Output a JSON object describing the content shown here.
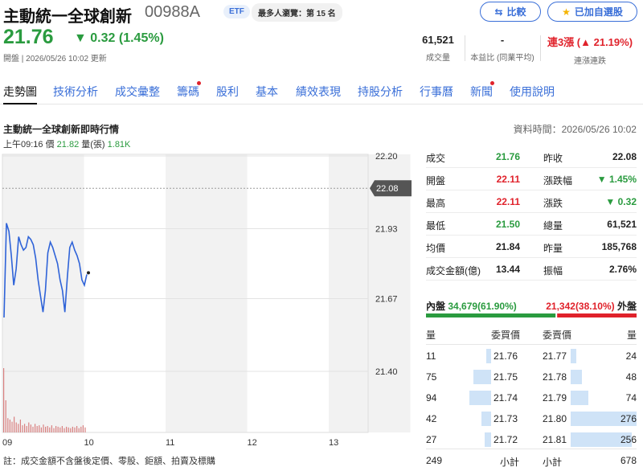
{
  "header": {
    "name": "主動統一全球創新",
    "code": "00988A",
    "etf_badge": "ETF",
    "popular_badge": "最多人瀏覽：第 15 名",
    "compare_label": "比較",
    "watchlist_label": "已加自選股",
    "price": "21.76",
    "change": "▼ 0.32 (1.45%)",
    "updated": "開盤 | 2026/05/26 10:02 更新",
    "stats": [
      {
        "value": "61,521",
        "label": "成交量"
      },
      {
        "value": "-",
        "label": "本益比 (同業平均)"
      },
      {
        "value": "連3漲 (▲ 21.19%)",
        "label": "連漲連跌"
      }
    ]
  },
  "tabs": [
    {
      "label": "走勢圖",
      "active": true,
      "dot": false
    },
    {
      "label": "技術分析",
      "dot": false
    },
    {
      "label": "成交彙整",
      "dot": false
    },
    {
      "label": "籌碼",
      "dot": true
    },
    {
      "label": "股利",
      "dot": false
    },
    {
      "label": "基本",
      "dot": false
    },
    {
      "label": "績效表現",
      "dot": false
    },
    {
      "label": "持股分析",
      "dot": false
    },
    {
      "label": "行事曆",
      "dot": false
    },
    {
      "label": "新聞",
      "dot": true
    },
    {
      "label": "使用說明",
      "dot": false
    }
  ],
  "section": {
    "title": "主動統一全球創新即時行情",
    "data_time": "資料時間：2026/05/26 10:02",
    "info_time": "上午09:16",
    "info_price_label": "價",
    "info_price": "21.82",
    "info_vol_label": "量(張)",
    "info_vol": "1.81K",
    "note": "註：成交金額不含盤後定價、零股、鉅額、拍賣及標購"
  },
  "chart_data": {
    "type": "line",
    "x_ticks": [
      "09",
      "10",
      "11",
      "12",
      "13"
    ],
    "y_ticks": [
      "22.20",
      "21.93",
      "21.67",
      "21.40"
    ],
    "ylim": [
      21.4,
      22.2
    ],
    "prev_close_label": "22.08",
    "prev_close": 22.08,
    "price_series": [
      21.6,
      21.95,
      21.92,
      21.83,
      21.72,
      21.78,
      21.9,
      21.87,
      21.85,
      21.86,
      21.9,
      21.89,
      21.87,
      21.82,
      21.74,
      21.68,
      21.62,
      21.7,
      21.84,
      21.88,
      21.86,
      21.83,
      21.8,
      21.74,
      21.7,
      21.62,
      21.75,
      21.86,
      21.88,
      21.85,
      21.83,
      21.8,
      21.74,
      21.72,
      21.76
    ],
    "volume_bars": [
      90,
      45,
      20,
      18,
      15,
      22,
      14,
      12,
      18,
      10,
      12,
      9,
      14,
      11,
      8,
      12,
      9,
      10,
      7,
      11,
      8,
      9,
      7,
      10,
      6,
      9,
      8,
      7,
      9,
      6,
      8,
      7,
      6,
      8,
      7,
      9,
      6,
      8,
      10,
      7
    ]
  },
  "quote": [
    {
      "l1": "成交",
      "v1": "21.76",
      "c1": "green",
      "l2": "昨收",
      "v2": "22.08",
      "c2": ""
    },
    {
      "l1": "開盤",
      "v1": "22.11",
      "c1": "red",
      "l2": "漲跌幅",
      "v2": "▼ 1.45%",
      "c2": "green"
    },
    {
      "l1": "最高",
      "v1": "22.11",
      "c1": "red",
      "l2": "漲跌",
      "v2": "▼ 0.32",
      "c2": "green"
    },
    {
      "l1": "最低",
      "v1": "21.50",
      "c1": "green",
      "l2": "總量",
      "v2": "61,521",
      "c2": ""
    },
    {
      "l1": "均價",
      "v1": "21.84",
      "c1": "",
      "l2": "昨量",
      "v2": "185,768",
      "c2": ""
    },
    {
      "l1": "成交金額(億)",
      "v1": "13.44",
      "c1": "",
      "l2": "振幅",
      "v2": "2.76%",
      "c2": ""
    }
  ],
  "bidask": {
    "inner_label": "內盤",
    "inner_value": "34,679(61.90%)",
    "outer_value": "21,342(38.10%)",
    "outer_label": "外盤",
    "inner_ratio": 0.619,
    "head_qty": "量",
    "head_bid": "委買價",
    "head_ask": "委賣價",
    "head_qty2": "量",
    "bids": [
      {
        "qty": "11",
        "price": "21.76",
        "level": 0.04
      },
      {
        "qty": "75",
        "price": "21.75",
        "level": 0.27
      },
      {
        "qty": "94",
        "price": "21.74",
        "level": 0.34
      },
      {
        "qty": "42",
        "price": "21.73",
        "level": 0.15
      },
      {
        "qty": "27",
        "price": "21.72",
        "level": 0.1
      }
    ],
    "asks": [
      {
        "price": "21.77",
        "qty": "24",
        "level": 0.09
      },
      {
        "price": "21.78",
        "qty": "48",
        "level": 0.17
      },
      {
        "price": "21.79",
        "qty": "74",
        "level": 0.27
      },
      {
        "price": "21.80",
        "qty": "276",
        "level": 1.0
      },
      {
        "price": "21.81",
        "qty": "256",
        "level": 0.93
      }
    ],
    "total_bid_qty": "249",
    "subtotal_label": "小計",
    "total_ask_qty": "678"
  },
  "colors": {
    "up": "#e0222b",
    "down": "#2a9b3f",
    "accent": "#3a6fd8",
    "line": "#2f63d8",
    "bar": "#cfe3f7"
  }
}
